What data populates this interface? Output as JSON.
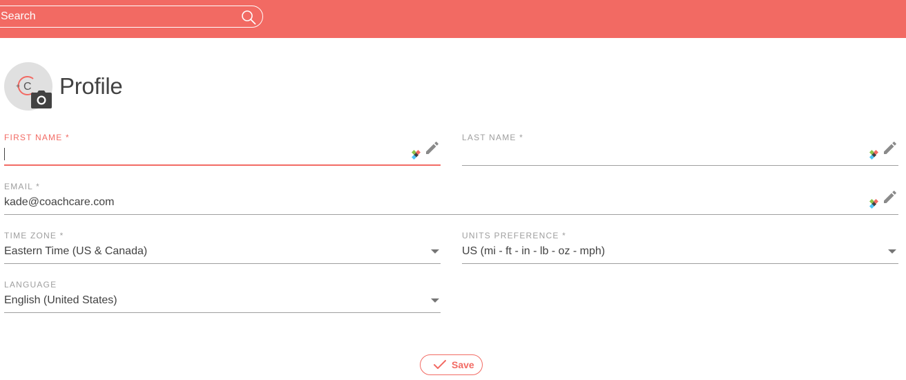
{
  "header": {
    "search_placeholder": "Search",
    "accent_color": "#f26a63"
  },
  "profile": {
    "title": "Profile"
  },
  "form": {
    "first_name": {
      "label": "FIRST NAME *",
      "value": ""
    },
    "last_name": {
      "label": "LAST NAME *",
      "value": ""
    },
    "email": {
      "label": "EMAIL *",
      "value": "kade@coachcare.com"
    },
    "time_zone": {
      "label": "TIME ZONE *",
      "value": "Eastern Time (US & Canada)"
    },
    "units_preference": {
      "label": "UNITS PREFERENCE *",
      "value": "US (mi - ft - in - lb - oz - mph)"
    },
    "language": {
      "label": "LANGUAGE",
      "value": "English (United States)"
    }
  },
  "actions": {
    "save_label": "Save"
  },
  "icons": {
    "search": "search-icon",
    "camera": "camera-icon",
    "pencil": "pencil-icon",
    "password_manager": "lastpass-icon",
    "dropdown": "dropdown-arrow-icon",
    "check": "check-icon"
  }
}
